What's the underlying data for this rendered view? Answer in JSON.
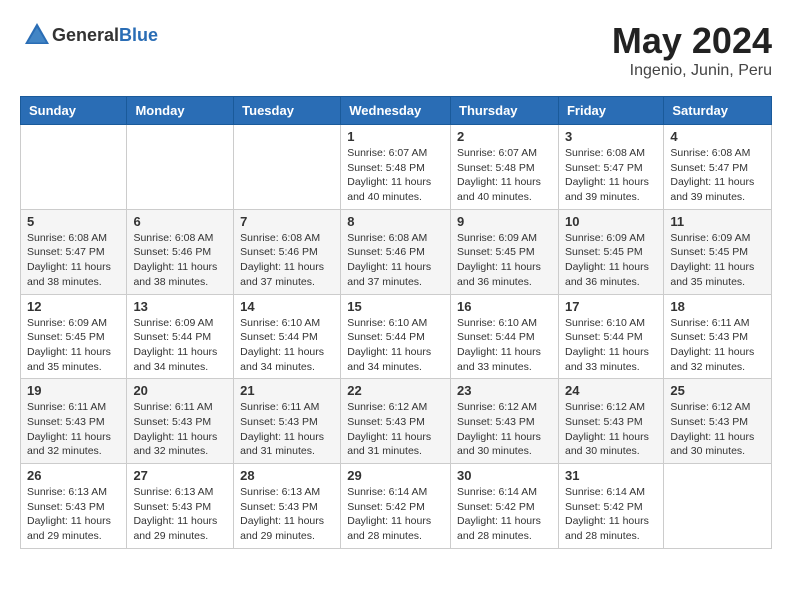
{
  "header": {
    "logo_general": "General",
    "logo_blue": "Blue",
    "title": "May 2024",
    "subtitle": "Ingenio, Junin, Peru"
  },
  "weekdays": [
    "Sunday",
    "Monday",
    "Tuesday",
    "Wednesday",
    "Thursday",
    "Friday",
    "Saturday"
  ],
  "weeks": [
    [
      {
        "day": "",
        "info": ""
      },
      {
        "day": "",
        "info": ""
      },
      {
        "day": "",
        "info": ""
      },
      {
        "day": "1",
        "info": "Sunrise: 6:07 AM\nSunset: 5:48 PM\nDaylight: 11 hours\nand 40 minutes."
      },
      {
        "day": "2",
        "info": "Sunrise: 6:07 AM\nSunset: 5:48 PM\nDaylight: 11 hours\nand 40 minutes."
      },
      {
        "day": "3",
        "info": "Sunrise: 6:08 AM\nSunset: 5:47 PM\nDaylight: 11 hours\nand 39 minutes."
      },
      {
        "day": "4",
        "info": "Sunrise: 6:08 AM\nSunset: 5:47 PM\nDaylight: 11 hours\nand 39 minutes."
      }
    ],
    [
      {
        "day": "5",
        "info": "Sunrise: 6:08 AM\nSunset: 5:47 PM\nDaylight: 11 hours\nand 38 minutes."
      },
      {
        "day": "6",
        "info": "Sunrise: 6:08 AM\nSunset: 5:46 PM\nDaylight: 11 hours\nand 38 minutes."
      },
      {
        "day": "7",
        "info": "Sunrise: 6:08 AM\nSunset: 5:46 PM\nDaylight: 11 hours\nand 37 minutes."
      },
      {
        "day": "8",
        "info": "Sunrise: 6:08 AM\nSunset: 5:46 PM\nDaylight: 11 hours\nand 37 minutes."
      },
      {
        "day": "9",
        "info": "Sunrise: 6:09 AM\nSunset: 5:45 PM\nDaylight: 11 hours\nand 36 minutes."
      },
      {
        "day": "10",
        "info": "Sunrise: 6:09 AM\nSunset: 5:45 PM\nDaylight: 11 hours\nand 36 minutes."
      },
      {
        "day": "11",
        "info": "Sunrise: 6:09 AM\nSunset: 5:45 PM\nDaylight: 11 hours\nand 35 minutes."
      }
    ],
    [
      {
        "day": "12",
        "info": "Sunrise: 6:09 AM\nSunset: 5:45 PM\nDaylight: 11 hours\nand 35 minutes."
      },
      {
        "day": "13",
        "info": "Sunrise: 6:09 AM\nSunset: 5:44 PM\nDaylight: 11 hours\nand 34 minutes."
      },
      {
        "day": "14",
        "info": "Sunrise: 6:10 AM\nSunset: 5:44 PM\nDaylight: 11 hours\nand 34 minutes."
      },
      {
        "day": "15",
        "info": "Sunrise: 6:10 AM\nSunset: 5:44 PM\nDaylight: 11 hours\nand 34 minutes."
      },
      {
        "day": "16",
        "info": "Sunrise: 6:10 AM\nSunset: 5:44 PM\nDaylight: 11 hours\nand 33 minutes."
      },
      {
        "day": "17",
        "info": "Sunrise: 6:10 AM\nSunset: 5:44 PM\nDaylight: 11 hours\nand 33 minutes."
      },
      {
        "day": "18",
        "info": "Sunrise: 6:11 AM\nSunset: 5:43 PM\nDaylight: 11 hours\nand 32 minutes."
      }
    ],
    [
      {
        "day": "19",
        "info": "Sunrise: 6:11 AM\nSunset: 5:43 PM\nDaylight: 11 hours\nand 32 minutes."
      },
      {
        "day": "20",
        "info": "Sunrise: 6:11 AM\nSunset: 5:43 PM\nDaylight: 11 hours\nand 32 minutes."
      },
      {
        "day": "21",
        "info": "Sunrise: 6:11 AM\nSunset: 5:43 PM\nDaylight: 11 hours\nand 31 minutes."
      },
      {
        "day": "22",
        "info": "Sunrise: 6:12 AM\nSunset: 5:43 PM\nDaylight: 11 hours\nand 31 minutes."
      },
      {
        "day": "23",
        "info": "Sunrise: 6:12 AM\nSunset: 5:43 PM\nDaylight: 11 hours\nand 30 minutes."
      },
      {
        "day": "24",
        "info": "Sunrise: 6:12 AM\nSunset: 5:43 PM\nDaylight: 11 hours\nand 30 minutes."
      },
      {
        "day": "25",
        "info": "Sunrise: 6:12 AM\nSunset: 5:43 PM\nDaylight: 11 hours\nand 30 minutes."
      }
    ],
    [
      {
        "day": "26",
        "info": "Sunrise: 6:13 AM\nSunset: 5:43 PM\nDaylight: 11 hours\nand 29 minutes."
      },
      {
        "day": "27",
        "info": "Sunrise: 6:13 AM\nSunset: 5:43 PM\nDaylight: 11 hours\nand 29 minutes."
      },
      {
        "day": "28",
        "info": "Sunrise: 6:13 AM\nSunset: 5:43 PM\nDaylight: 11 hours\nand 29 minutes."
      },
      {
        "day": "29",
        "info": "Sunrise: 6:14 AM\nSunset: 5:42 PM\nDaylight: 11 hours\nand 28 minutes."
      },
      {
        "day": "30",
        "info": "Sunrise: 6:14 AM\nSunset: 5:42 PM\nDaylight: 11 hours\nand 28 minutes."
      },
      {
        "day": "31",
        "info": "Sunrise: 6:14 AM\nSunset: 5:42 PM\nDaylight: 11 hours\nand 28 minutes."
      },
      {
        "day": "",
        "info": ""
      }
    ]
  ]
}
